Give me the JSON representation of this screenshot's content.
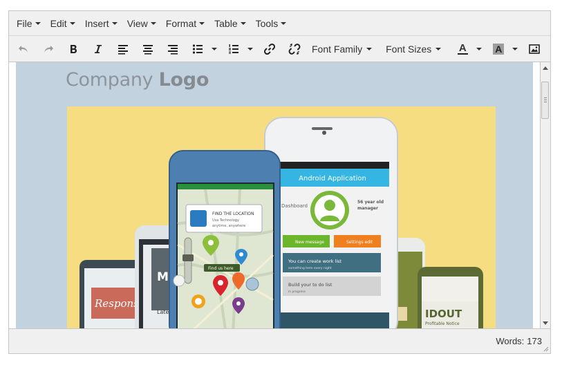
{
  "menubar": {
    "items": [
      {
        "label": "File"
      },
      {
        "label": "Edit"
      },
      {
        "label": "Insert"
      },
      {
        "label": "View"
      },
      {
        "label": "Format"
      },
      {
        "label": "Table"
      },
      {
        "label": "Tools"
      }
    ]
  },
  "toolbar": {
    "font_family_label": "Font Family",
    "font_sizes_label": "Font Sizes",
    "text_color_letter": "A",
    "bg_color_letter": "A",
    "icons": [
      "undo-icon",
      "redo-icon",
      "bold-icon",
      "italic-icon",
      "align-left-icon",
      "align-center-icon",
      "align-right-icon",
      "bullet-list-icon",
      "numbered-list-icon",
      "link-icon",
      "unlink-icon",
      "image-icon"
    ]
  },
  "content": {
    "logo_light": "Company ",
    "logo_bold": "Logo",
    "hero_image": {
      "popup_title": "FIND THE LOCATION",
      "popup_line1": "Usa Technology",
      "popup_line2": "anytime, anywhere",
      "map_tag": "Find us here",
      "app_header": "Android Application",
      "dashboard_label": "Dashboard",
      "manager_line1": "56 year old",
      "manager_line2": "manager",
      "btn_new_message": "New message",
      "btn_settings": "Settings edit",
      "card1_title": "You can create work list",
      "card1_sub": "something here every night",
      "card2_title": "Build your to do list",
      "card2_sub": "in progress",
      "left_phone_text1": "Mo",
      "left_phone_text2": "Lates",
      "left_phone_text3": "Responsi",
      "right_phone_text1": "IDOUT",
      "right_phone_text2": "Profitable Notice"
    },
    "colors": {
      "email_bg": "#c2d3df",
      "hero_bg": "#f7dd82",
      "app_header": "#35b6e2",
      "green_btn": "#6cb62b",
      "orange_btn": "#f07f20"
    }
  },
  "statusbar": {
    "words_label": "Words:",
    "words_count": "173"
  }
}
